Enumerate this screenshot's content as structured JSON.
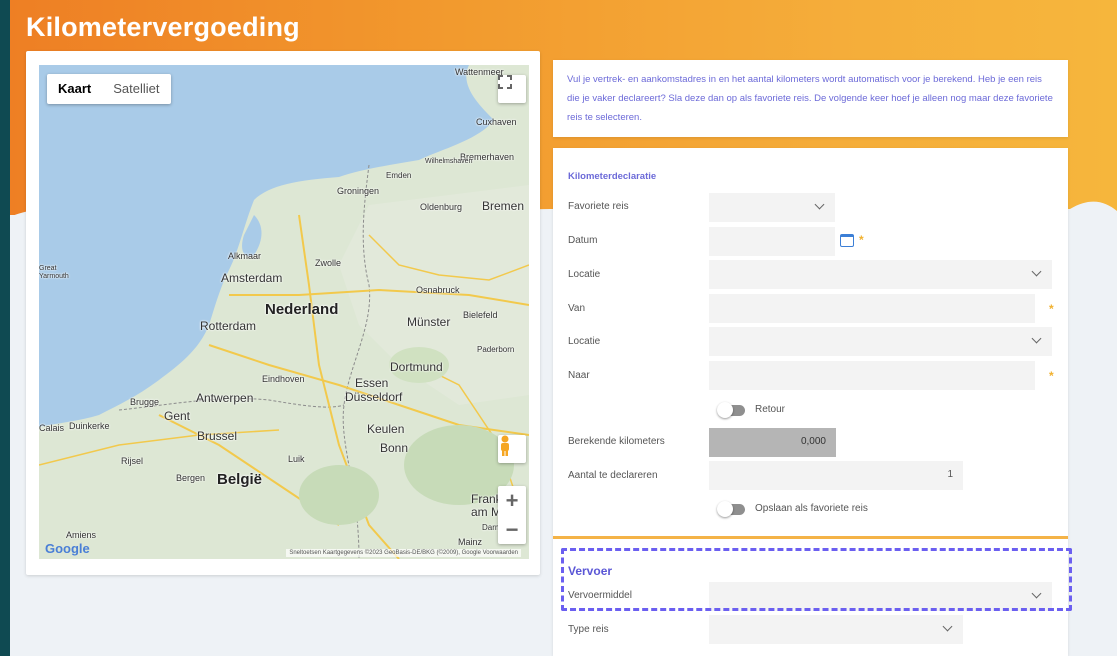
{
  "page": {
    "title": "Kilometervergoeding"
  },
  "map": {
    "type_buttons": [
      {
        "label": "Kaart",
        "active": true
      },
      {
        "label": "Satelliet",
        "active": false
      }
    ],
    "logo": "Google",
    "attribution": "Sneltoetsen   Kaartgegevens ©2023 GeoBasis-DE/BKG (©2009), Google   Voorwaarden",
    "places": {
      "wattenmeer": "Wattenmeer",
      "cuxhaven": "Cuxhaven",
      "bremerhaven": "Bremerhaven",
      "wilhelmshaven": "Wilhelmshaven",
      "emden": "Emden",
      "groningen": "Groningen",
      "oldenburg": "Oldenburg",
      "bremen": "Bremen",
      "alkmaar": "Alkmaar",
      "zwolle": "Zwolle",
      "amsterdam": "Amsterdam",
      "great_yarmouth": "Great\nYarmouth",
      "osnabruck": "Osnabruck",
      "nederland": "Nederland",
      "bielefeld": "Bielefeld",
      "rotterdam": "Rotterdam",
      "munster": "Münster",
      "paderborn": "Paderborn",
      "dortmund": "Dortmund",
      "eindhoven": "Eindhoven",
      "essen": "Essen",
      "antwerpen": "Antwerpen",
      "brugge": "Brugge",
      "dusseldorf": "Düsseldorf",
      "gent": "Gent",
      "calais": "Calais",
      "dunkerke": "Duinkerke",
      "brussel": "Brussel",
      "keulen": "Keulen",
      "bonn": "Bonn",
      "rijsel": "Rijsel",
      "luik": "Luik",
      "bergen": "Bergen",
      "belgie": "België",
      "frankfurt": "Frank\nam M",
      "amiens": "Amiens",
      "mainz": "Mainz",
      "darmstadt": "Darmstad"
    }
  },
  "info": {
    "text": "Vul je vertrek- en aankomstadres in en het aantal kilometers wordt automatisch voor je berekend. Heb je een reis die je vaker declareert? Sla deze dan op als favoriete reis. De volgende keer hoef je alleen nog maar deze favoriete reis te selecteren."
  },
  "form": {
    "section_title": "Kilometerdeclaratie",
    "favoriete_reis_label": "Favoriete reis",
    "datum_label": "Datum",
    "locatie1_label": "Locatie",
    "van_label": "Van",
    "locatie2_label": "Locatie",
    "naar_label": "Naar",
    "retour_label": "Retour",
    "berekende_km_label": "Berekende kilometers",
    "berekende_km_value": "0,000",
    "aantal_label": "Aantal te declareren",
    "aantal_value": "1",
    "opslaan_label": "Opslaan als favoriete reis",
    "required_mark": "*"
  },
  "vervoer": {
    "title": "Vervoer",
    "vervoermiddel_label": "Vervoermiddel",
    "type_reis_label": "Type reis"
  },
  "colors": {
    "accent": "#6c6ad8",
    "banner_orange": "#ee7f24",
    "required": "#f1b12f",
    "highlight_border": "#6b5ff0"
  }
}
